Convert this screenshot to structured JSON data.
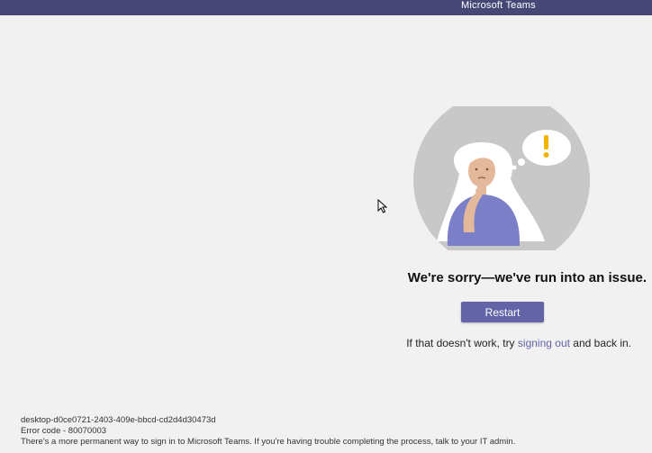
{
  "window": {
    "title": "Microsoft Teams",
    "titlebar_color": "#464775"
  },
  "main": {
    "illustration_icon": "confused-person-with-exclamation-illustration",
    "heading": "We're sorry—we've run into an issue.",
    "restart_label": "Restart",
    "retry_prefix": "If that doesn't work, try ",
    "retry_link": "signing out",
    "retry_suffix": " and back in.",
    "accent_color": "#6264a7"
  },
  "footer": {
    "device_id": "desktop-d0ce0721-2403-409e-bbcd-cd2d4d30473d",
    "error_code": "Error code - 80070003",
    "message": "There's a more permanent way to sign in to Microsoft Teams. If you're having trouble completing the process, talk to your IT admin."
  },
  "cursor_icon": "mouse-pointer-icon"
}
